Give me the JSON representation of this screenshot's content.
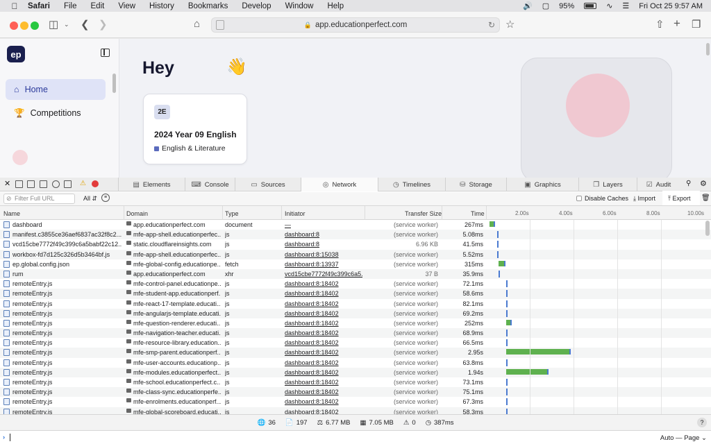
{
  "menubar": {
    "app": "Safari",
    "items": [
      "File",
      "Edit",
      "View",
      "History",
      "Bookmarks",
      "Develop",
      "Window",
      "Help"
    ],
    "battery": "95%",
    "datetime": "Fri Oct 25  9:57 AM"
  },
  "browser": {
    "url": "app.educationperfect.com"
  },
  "page": {
    "logo": "ep",
    "nav": [
      {
        "label": "Home",
        "icon": "home-icon",
        "active": true
      },
      {
        "label": "Competitions",
        "icon": "trophy-icon",
        "active": false
      }
    ],
    "greeting": "Hey",
    "wave": "👋",
    "course": {
      "badge": "2E",
      "title": "2024 Year 09 English",
      "subject": "English & Literature"
    }
  },
  "inspector": {
    "tabs": [
      {
        "label": "Elements",
        "icon": "▤"
      },
      {
        "label": "Console",
        "icon": "⌨"
      },
      {
        "label": "Sources",
        "icon": "▭"
      },
      {
        "label": "Network",
        "icon": "◎",
        "active": true
      },
      {
        "label": "Timelines",
        "icon": "◷"
      },
      {
        "label": "Storage",
        "icon": "⛁"
      },
      {
        "label": "Graphics",
        "icon": "▣"
      },
      {
        "label": "Layers",
        "icon": "❐"
      },
      {
        "label": "Audit",
        "icon": "☑"
      }
    ],
    "warning_icon": "⚠",
    "filter_placeholder": "Filter Full URL",
    "filter_type": "All",
    "disable_caches": "Disable Caches",
    "import_label": "Import",
    "export_label": "Export",
    "columns": {
      "name": "Name",
      "domain": "Domain",
      "type": "Type",
      "initiator": "Initiator",
      "size": "Transfer Size",
      "time": "Time"
    },
    "waterfall_ticks": [
      "2.00s",
      "4.00s",
      "6.00s",
      "8.00s",
      "10.00s"
    ],
    "requests": [
      {
        "name": "dashboard",
        "domain": "app.educationperfect.com",
        "type": "document",
        "initiator": "—",
        "size": "(service worker)",
        "time": "267ms",
        "start": 0.0,
        "dur": 0.267
      },
      {
        "name": "manifest.c3855ce36aef6837ac32f8c2...",
        "domain": "mfe-app-shell.educationperfec...",
        "type": "js",
        "initiator": "dashboard:8",
        "size": "(service worker)",
        "time": "5.08ms",
        "start": 0.35,
        "dur": 0.005
      },
      {
        "name": "vcd15cbe7772f49c399c6a5babf22c12...",
        "domain": "static.cloudflareinsights.com",
        "type": "js",
        "initiator": "dashboard:8",
        "size": "6.96 KB",
        "time": "41.5ms",
        "start": 0.35,
        "dur": 0.0415
      },
      {
        "name": "workbox-fd7d125c326d5b3464bf.js",
        "domain": "mfe-app-shell.educationperfec...",
        "type": "js",
        "initiator": "dashboard:8:15038",
        "size": "(service worker)",
        "time": "5.52ms",
        "start": 0.36,
        "dur": 0.0055
      },
      {
        "name": "ep.global.config.json",
        "domain": "mfe-global-config.educationpe...",
        "type": "fetch",
        "initiator": "dashboard:8:13937",
        "size": "(service worker)",
        "time": "315ms",
        "start": 0.4,
        "dur": 0.315
      },
      {
        "name": "rum",
        "domain": "app.educationperfect.com",
        "type": "xhr",
        "initiator": "vcd15cbe7772f49c399c6a5...",
        "size": "37 B",
        "time": "35.9ms",
        "start": 0.4,
        "dur": 0.0359
      },
      {
        "name": "remoteEntry.js",
        "domain": "mfe-control-panel.educationpe...",
        "type": "js",
        "initiator": "dashboard:8:18402",
        "size": "(service worker)",
        "time": "72.1ms",
        "start": 0.75,
        "dur": 0.0721
      },
      {
        "name": "remoteEntry.js",
        "domain": "mfe-student-app.educationperf...",
        "type": "js",
        "initiator": "dashboard:8:18402",
        "size": "(service worker)",
        "time": "58.6ms",
        "start": 0.75,
        "dur": 0.0586
      },
      {
        "name": "remoteEntry.js",
        "domain": "mfe-react-17-template.educati...",
        "type": "js",
        "initiator": "dashboard:8:18402",
        "size": "(service worker)",
        "time": "82.1ms",
        "start": 0.75,
        "dur": 0.0821
      },
      {
        "name": "remoteEntry.js",
        "domain": "mfe-angularjs-template.educati...",
        "type": "js",
        "initiator": "dashboard:8:18402",
        "size": "(service worker)",
        "time": "69.2ms",
        "start": 0.75,
        "dur": 0.0692
      },
      {
        "name": "remoteEntry.js",
        "domain": "mfe-question-renderer.educati...",
        "type": "js",
        "initiator": "dashboard:8:18402",
        "size": "(service worker)",
        "time": "252ms",
        "start": 0.75,
        "dur": 0.252
      },
      {
        "name": "remoteEntry.js",
        "domain": "mfe-navigation-teacher.educati...",
        "type": "js",
        "initiator": "dashboard:8:18402",
        "size": "(service worker)",
        "time": "68.9ms",
        "start": 0.75,
        "dur": 0.0689
      },
      {
        "name": "remoteEntry.js",
        "domain": "mfe-resource-library.education...",
        "type": "js",
        "initiator": "dashboard:8:18402",
        "size": "(service worker)",
        "time": "66.5ms",
        "start": 0.75,
        "dur": 0.0665
      },
      {
        "name": "remoteEntry.js",
        "domain": "mfe-smp-parent.educationperf...",
        "type": "js",
        "initiator": "dashboard:8:18402",
        "size": "(service worker)",
        "time": "2.95s",
        "start": 0.75,
        "dur": 2.95
      },
      {
        "name": "remoteEntry.js",
        "domain": "mfe-user-accounts.educationp...",
        "type": "js",
        "initiator": "dashboard:8:18402",
        "size": "(service worker)",
        "time": "63.8ms",
        "start": 0.75,
        "dur": 0.0638
      },
      {
        "name": "remoteEntry.js",
        "domain": "mfe-modules.educationperfect...",
        "type": "js",
        "initiator": "dashboard:8:18402",
        "size": "(service worker)",
        "time": "1.94s",
        "start": 0.75,
        "dur": 1.94
      },
      {
        "name": "remoteEntry.js",
        "domain": "mfe-school.educationperfect.c...",
        "type": "js",
        "initiator": "dashboard:8:18402",
        "size": "(service worker)",
        "time": "73.1ms",
        "start": 0.75,
        "dur": 0.0731
      },
      {
        "name": "remoteEntry.js",
        "domain": "mfe-class-sync.educationperfe...",
        "type": "js",
        "initiator": "dashboard:8:18402",
        "size": "(service worker)",
        "time": "75.1ms",
        "start": 0.75,
        "dur": 0.0751
      },
      {
        "name": "remoteEntry.js",
        "domain": "mfe-enrolments.educationperf...",
        "type": "js",
        "initiator": "dashboard:8:18402",
        "size": "(service worker)",
        "time": "67.3ms",
        "start": 0.75,
        "dur": 0.0673
      },
      {
        "name": "remoteEntry.js",
        "domain": "mfe-global-scoreboard.educati...",
        "type": "js",
        "initiator": "dashboard:8:18402",
        "size": "(service worker)",
        "time": "58.3ms",
        "start": 0.75,
        "dur": 0.0583
      }
    ],
    "summary": {
      "requests": "36",
      "resources": "197",
      "transferred": "6.77 MB",
      "size": "7.05 MB",
      "errors": "0",
      "load_time": "387ms"
    },
    "help_label": "?",
    "console_context": "Auto — Page"
  },
  "colors": {
    "accent": "#2b3a9b",
    "bar_green": "#5fb14f",
    "bar_blue": "#4a7ad0",
    "logo_bg": "#1a1f4e"
  }
}
